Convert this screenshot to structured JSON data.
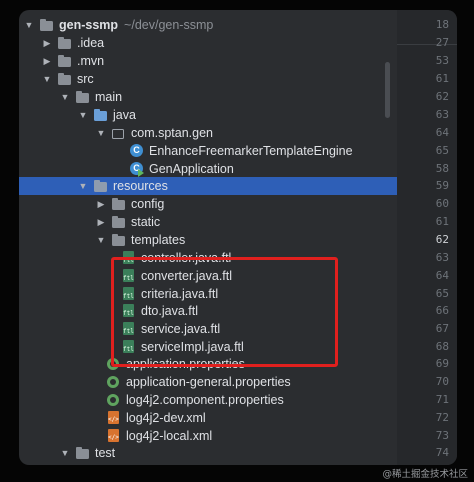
{
  "project": {
    "name": "gen-ssmp",
    "path": "~/dev/gen-ssmp"
  },
  "tree": [
    {
      "name": "project-root",
      "label": "gen-ssmp",
      "icon": "folder-icon",
      "expanded": true
    },
    {
      "name": "folder-idea",
      "label": ".idea",
      "icon": "folder-icon",
      "expanded": false
    },
    {
      "name": "folder-mvn",
      "label": ".mvn",
      "icon": "folder-icon",
      "expanded": false
    },
    {
      "name": "folder-src",
      "label": "src",
      "icon": "folder-icon",
      "expanded": true
    },
    {
      "name": "folder-main",
      "label": "main",
      "icon": "folder-icon",
      "expanded": true
    },
    {
      "name": "folder-java",
      "label": "java",
      "icon": "source-folder-icon",
      "expanded": true
    },
    {
      "name": "package-com-sptan-gen",
      "label": "com.sptan.gen",
      "icon": "package-icon",
      "expanded": true
    },
    {
      "name": "class-enhance-freemarker",
      "label": "EnhanceFreemarkerTemplateEngine",
      "icon": "java-class-icon"
    },
    {
      "name": "class-gen-application",
      "label": "GenApplication",
      "icon": "spring-boot-class-icon"
    },
    {
      "name": "folder-resources",
      "label": "resources",
      "icon": "resources-folder-icon",
      "expanded": true,
      "selected": true
    },
    {
      "name": "folder-config",
      "label": "config",
      "icon": "folder-icon",
      "expanded": false
    },
    {
      "name": "folder-static",
      "label": "static",
      "icon": "folder-icon",
      "expanded": false
    },
    {
      "name": "folder-templates",
      "label": "templates",
      "icon": "folder-icon",
      "expanded": true
    },
    {
      "name": "file-controller-ftl",
      "label": "controller.java.ftl",
      "icon": "ftl-file-icon"
    },
    {
      "name": "file-converter-ftl",
      "label": "converter.java.ftl",
      "icon": "ftl-file-icon"
    },
    {
      "name": "file-criteria-ftl",
      "label": "criteria.java.ftl",
      "icon": "ftl-file-icon"
    },
    {
      "name": "file-dto-ftl",
      "label": "dto.java.ftl",
      "icon": "ftl-file-icon"
    },
    {
      "name": "file-service-ftl",
      "label": "service.java.ftl",
      "icon": "ftl-file-icon"
    },
    {
      "name": "file-serviceimpl-ftl",
      "label": "serviceImpl.java.ftl",
      "icon": "ftl-file-icon"
    },
    {
      "name": "file-application-properties",
      "label": "application.properties",
      "icon": "properties-file-icon"
    },
    {
      "name": "file-application-general-properties",
      "label": "application-general.properties",
      "icon": "properties-file-icon"
    },
    {
      "name": "file-log4j2-component-properties",
      "label": "log4j2.component.properties",
      "icon": "properties-file-icon"
    },
    {
      "name": "file-log4j2-dev-xml",
      "label": "log4j2-dev.xml",
      "icon": "xml-file-icon"
    },
    {
      "name": "file-log4j2-local-xml",
      "label": "log4j2-local.xml",
      "icon": "xml-file-icon"
    },
    {
      "name": "folder-test",
      "label": "test",
      "icon": "folder-icon",
      "expanded": true
    }
  ],
  "gutter": {
    "line_numbers": [
      "18",
      "27",
      "53",
      "61",
      "62",
      "63",
      "64",
      "65",
      "58",
      "59",
      "60",
      "61",
      "62",
      "63",
      "64",
      "65",
      "66",
      "67",
      "68",
      "69",
      "70",
      "71",
      "72",
      "73",
      "74"
    ],
    "current_line": "62"
  },
  "watermark": "@稀土掘金技术社区",
  "colors": {
    "panel_bg": "#2b2d30",
    "selection": "#2e5fb7",
    "highlight_box": "#e0201e",
    "text": "#dfe1e5"
  }
}
